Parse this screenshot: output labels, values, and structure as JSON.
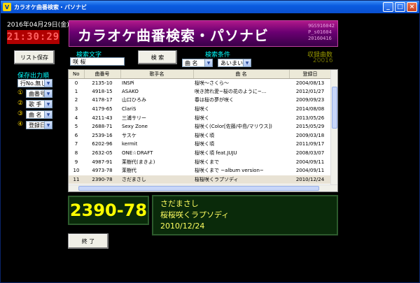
{
  "window": {
    "title": "カラオケ曲番検索・パソナビ",
    "app_icon_letter": "V"
  },
  "header": {
    "date": "2016年04月29日(金)",
    "clock": "21:30:29",
    "banner_title": "カラオケ曲番検索・パソナビ",
    "codes": [
      "9GS916042",
      "P_s01604",
      "20160416"
    ]
  },
  "buttons": {
    "save_list": "リスト保存",
    "search": "検 索",
    "exit": "終 了"
  },
  "search": {
    "label": "検索文字",
    "value": "咲 桜"
  },
  "condition": {
    "label": "検索条件",
    "field_select": "曲 名",
    "match_select": "あいまい"
  },
  "count": {
    "label": "収録曲数",
    "value": "20016"
  },
  "save_order": {
    "label": "保存出力順",
    "top_select": "行No.無し",
    "rows": [
      {
        "num": "①",
        "value": "曲番号"
      },
      {
        "num": "②",
        "value": "歌 手"
      },
      {
        "num": "③",
        "value": "曲 名"
      },
      {
        "num": "④",
        "value": "登録日"
      }
    ]
  },
  "table": {
    "headers": [
      "No",
      "曲番号",
      "歌手名",
      "曲 名",
      "登録日"
    ],
    "rows": [
      [
        "0",
        "2135-10",
        "INSPi",
        "桜咲～さくら～",
        "2004/08/13"
      ],
      [
        "1",
        "4918-15",
        "ASAKO",
        "咲き誇れ愛~桜の花のように~...",
        "2012/01/27"
      ],
      [
        "2",
        "4178-17",
        "山口ひろみ",
        "春は桜の夢が咲く",
        "2009/09/23"
      ],
      [
        "3",
        "4179-65",
        "ClariS",
        "桜咲く",
        "2014/08/08"
      ],
      [
        "4",
        "4211-43",
        "三浦サリー",
        "桜咲く",
        "2013/05/26"
      ],
      [
        "5",
        "2688-71",
        "Sexy Zone",
        "桜咲く(Color[佐藤/中島/マリウス])",
        "2015/05/29"
      ],
      [
        "6",
        "2539-16",
        "サスケ",
        "桜咲く頃",
        "2009/03/18"
      ],
      [
        "7",
        "6202-96",
        "kermit",
        "桜咲く頃",
        "2011/09/17"
      ],
      [
        "8",
        "2632-05",
        "ONE☆DRAFT",
        "桜咲く頃 feat.JUJU",
        "2008/03/07"
      ],
      [
        "9",
        "4987-91",
        "茉樹代(まきよ)",
        "桜咲くまで",
        "2004/09/11"
      ],
      [
        "10",
        "4973-78",
        "茉樹代",
        "桜咲くまで ~album version~",
        "2004/09/11"
      ],
      [
        "11",
        "2390-78",
        "さだまさし",
        "桜桜咲くラプソディ",
        "2010/12/24"
      ]
    ]
  },
  "selected": {
    "number": "2390-78",
    "artist": "さだまさし",
    "title": "桜桜咲くラプソディ",
    "date": "2010/12/24"
  }
}
